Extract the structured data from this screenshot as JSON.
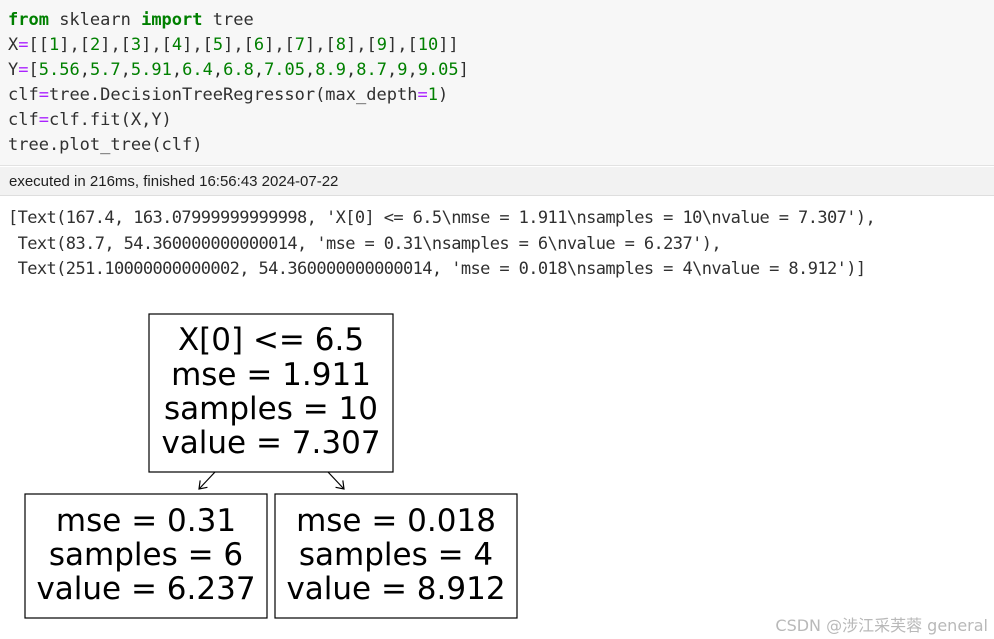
{
  "code_cell": {
    "lines": [
      [
        {
          "t": "from",
          "c": "kw"
        },
        {
          "t": " sklearn ",
          "c": ""
        },
        {
          "t": "import",
          "c": "kw"
        },
        {
          "t": " tree",
          "c": ""
        }
      ],
      [
        {
          "t": "X",
          "c": ""
        },
        {
          "t": "=",
          "c": "op"
        },
        {
          "t": "[[",
          "c": ""
        },
        {
          "t": "1",
          "c": "num"
        },
        {
          "t": "],[",
          "c": ""
        },
        {
          "t": "2",
          "c": "num"
        },
        {
          "t": "],[",
          "c": ""
        },
        {
          "t": "3",
          "c": "num"
        },
        {
          "t": "],[",
          "c": ""
        },
        {
          "t": "4",
          "c": "num"
        },
        {
          "t": "],[",
          "c": ""
        },
        {
          "t": "5",
          "c": "num"
        },
        {
          "t": "],[",
          "c": ""
        },
        {
          "t": "6",
          "c": "num"
        },
        {
          "t": "],[",
          "c": ""
        },
        {
          "t": "7",
          "c": "num"
        },
        {
          "t": "],[",
          "c": ""
        },
        {
          "t": "8",
          "c": "num"
        },
        {
          "t": "],[",
          "c": ""
        },
        {
          "t": "9",
          "c": "num"
        },
        {
          "t": "],[",
          "c": ""
        },
        {
          "t": "10",
          "c": "num"
        },
        {
          "t": "]]",
          "c": ""
        }
      ],
      [
        {
          "t": "Y",
          "c": ""
        },
        {
          "t": "=",
          "c": "op"
        },
        {
          "t": "[",
          "c": ""
        },
        {
          "t": "5.56",
          "c": "num"
        },
        {
          "t": ",",
          "c": ""
        },
        {
          "t": "5.7",
          "c": "num"
        },
        {
          "t": ",",
          "c": ""
        },
        {
          "t": "5.91",
          "c": "num"
        },
        {
          "t": ",",
          "c": ""
        },
        {
          "t": "6.4",
          "c": "num"
        },
        {
          "t": ",",
          "c": ""
        },
        {
          "t": "6.8",
          "c": "num"
        },
        {
          "t": ",",
          "c": ""
        },
        {
          "t": "7.05",
          "c": "num"
        },
        {
          "t": ",",
          "c": ""
        },
        {
          "t": "8.9",
          "c": "num"
        },
        {
          "t": ",",
          "c": ""
        },
        {
          "t": "8.7",
          "c": "num"
        },
        {
          "t": ",",
          "c": ""
        },
        {
          "t": "9",
          "c": "num"
        },
        {
          "t": ",",
          "c": ""
        },
        {
          "t": "9.05",
          "c": "num"
        },
        {
          "t": "]",
          "c": ""
        }
      ],
      [
        {
          "t": "clf",
          "c": ""
        },
        {
          "t": "=",
          "c": "op"
        },
        {
          "t": "tree.DecisionTreeRegressor(max_depth",
          "c": ""
        },
        {
          "t": "=",
          "c": "op"
        },
        {
          "t": "1",
          "c": "num"
        },
        {
          "t": ")",
          "c": ""
        }
      ],
      [
        {
          "t": "clf",
          "c": ""
        },
        {
          "t": "=",
          "c": "op"
        },
        {
          "t": "clf.fit(X,Y)",
          "c": ""
        }
      ],
      [
        {
          "t": "tree.plot_tree(clf)",
          "c": ""
        }
      ]
    ]
  },
  "execution_status": "executed in 216ms, finished 16:56:43 2024-07-22",
  "output_lines": [
    "[Text(167.4, 163.07999999999998, 'X[0] <= 6.5\\nmse = 1.911\\nsamples = 10\\nvalue = 7.307'),",
    " Text(83.7, 54.360000000000014, 'mse = 0.31\\nsamples = 6\\nvalue = 6.237'),",
    " Text(251.10000000000002, 54.360000000000014, 'mse = 0.018\\nsamples = 4\\nvalue = 8.912')]"
  ],
  "tree": {
    "root": [
      "X[0] <= 6.5",
      "mse = 1.911",
      "samples = 10",
      "value = 7.307"
    ],
    "left": [
      "mse = 0.31",
      "samples = 6",
      "value = 6.237"
    ],
    "right": [
      "mse = 0.018",
      "samples = 4",
      "value = 8.912"
    ]
  },
  "watermark": "CSDN @涉江采芙蓉 general",
  "colors": {
    "keyword": "#008000",
    "operator": "#aa22ff",
    "number": "#008000",
    "cell_bg": "#f7f7f7"
  }
}
